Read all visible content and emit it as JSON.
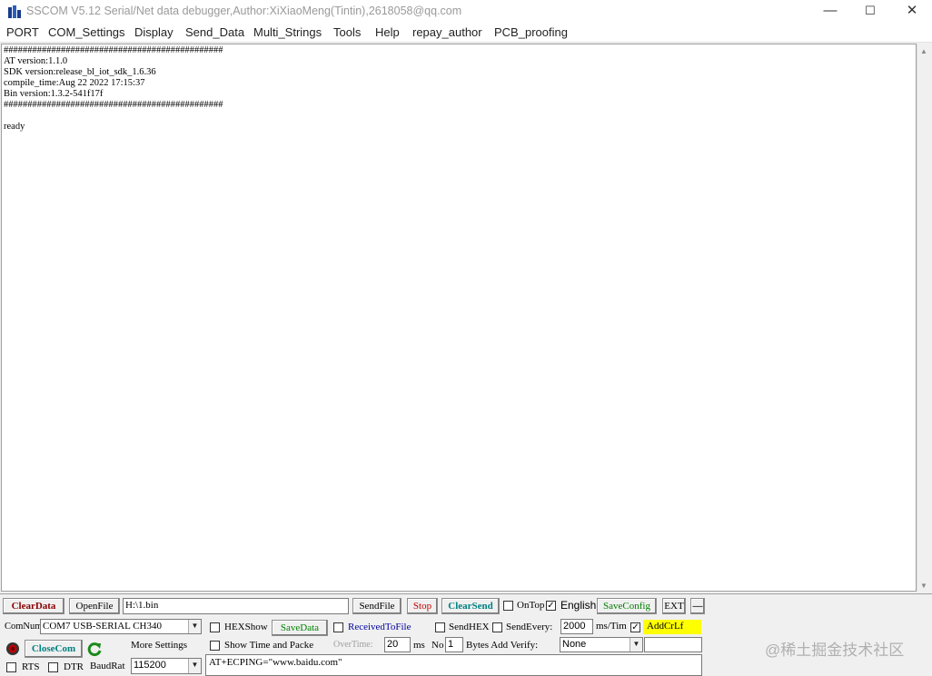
{
  "window": {
    "title": "SSCOM V5.12 Serial/Net data debugger,Author:XiXiaoMeng(Tintin),2618058@qq.com",
    "minimize": "—",
    "maximize": "☐",
    "close": "✕"
  },
  "menu": [
    "PORT",
    "COM_Settings",
    "Display",
    "Send_Data",
    "Multi_Strings",
    "Tools",
    "Help",
    "repay_author",
    "PCB_proofing"
  ],
  "terminal": {
    "text": "##############################################\nAT version:1.1.0\nSDK version:release_bl_iot_sdk_1.6.36\ncompile_time:Aug 22 2022 17:15:37\nBin version:1.3.2-541f17f\n##############################################\n\nready"
  },
  "row1": {
    "clear_data": "ClearData",
    "open_file": "OpenFile",
    "file_path": "H:\\1.bin",
    "send_file": "SendFile",
    "stop": "Stop",
    "clear_send": "ClearSend",
    "on_top_label": "OnTop",
    "english_label": "English",
    "save_config": "SaveConfig",
    "ext": "EXT",
    "dash": "—"
  },
  "row2": {
    "comnum_label": "ComNum",
    "com_port": "COM7 USB-SERIAL CH340",
    "hexshow_label": "HEXShow",
    "save_data": "SaveData",
    "received_to_file": "ReceivedToFile",
    "send_hex_label": "SendHEX",
    "send_every_label": "SendEvery:",
    "send_every_value": "2000",
    "ms_tim_label": "ms/Tim",
    "add_crlf_label": "AddCrLf"
  },
  "row3": {
    "close_com": "CloseCom",
    "more_settings": "More Settings",
    "show_time_label": "Show Time and Packe",
    "overtime_label": "OverTime:",
    "overtime_value": "20",
    "ms_label": "ms",
    "no_label": "No",
    "no_value": "1",
    "bytes_label": "Bytes Add Verify:",
    "verify_value": "None"
  },
  "row4": {
    "rts_label": "RTS",
    "dtr_label": "DTR",
    "baud_label": "BaudRat",
    "baud_value": "115200",
    "send_text": "AT+ECPING=\"www.baidu.com\""
  },
  "watermark": "@稀土掘金技术社区",
  "colors": {
    "clear_data": "#8b0000",
    "stop": "#c00000",
    "clear_send": "#008080",
    "save_config": "#008000",
    "received_to_file": "#0000a0",
    "add_crlf_bg": "#ffff00"
  }
}
